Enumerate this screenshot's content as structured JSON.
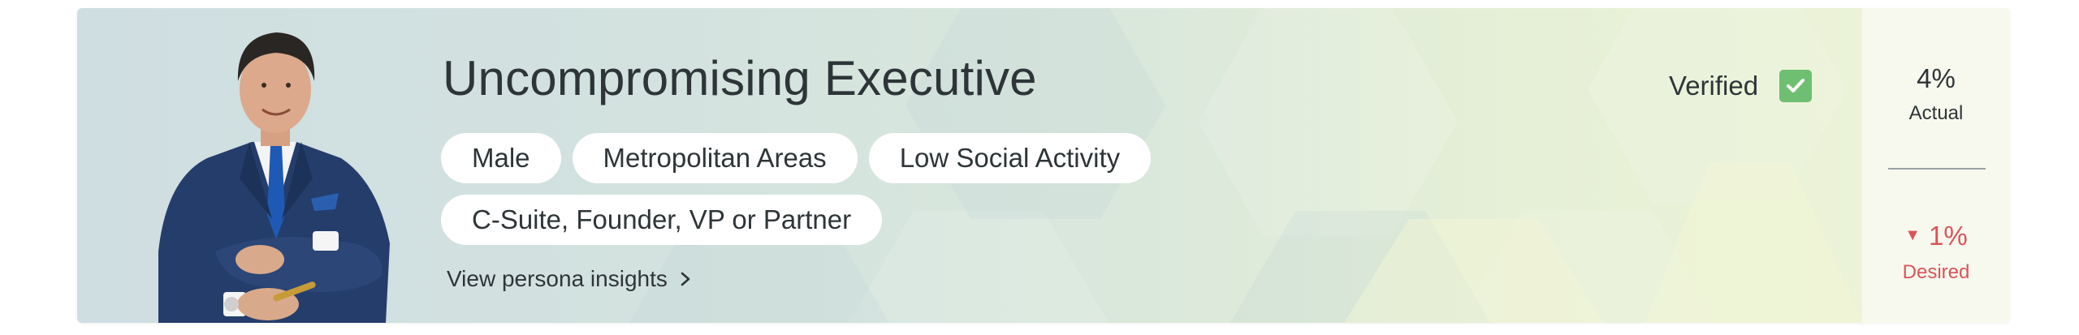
{
  "persona": {
    "title": "Uncompromising Executive",
    "tags_row1": [
      "Male",
      "Metropolitan Areas",
      "Low Social Activity"
    ],
    "tags_row2": [
      "C-Suite, Founder, VP or Partner"
    ],
    "insights_link": "View persona insights"
  },
  "verification": {
    "label": "Verified",
    "checked": true,
    "color": "#6fbf73"
  },
  "stats": {
    "actual_value": "4%",
    "actual_label": "Actual",
    "desired_value": "1%",
    "desired_label": "Desired",
    "desired_trend": "down",
    "desired_color": "#d9545a"
  },
  "icons": {
    "insights": "chevron-right-icon",
    "verified": "checkmark-icon",
    "trend": "triangle-down-icon"
  }
}
